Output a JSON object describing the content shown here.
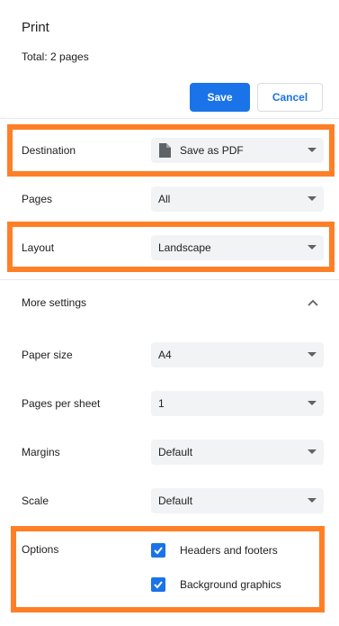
{
  "header": {
    "title": "Print",
    "total_label": "Total: ",
    "total_value": "2 pages"
  },
  "buttons": {
    "save": "Save",
    "cancel": "Cancel"
  },
  "settings": {
    "destination": {
      "label": "Destination",
      "value": "Save as PDF",
      "icon": "document-icon"
    },
    "pages": {
      "label": "Pages",
      "value": "All"
    },
    "layout": {
      "label": "Layout",
      "value": "Landscape"
    },
    "more_settings": {
      "label": "More settings",
      "icon": "chevron-up-icon"
    },
    "paper_size": {
      "label": "Paper size",
      "value": "A4"
    },
    "pages_per_sheet": {
      "label": "Pages per sheet",
      "value": "1"
    },
    "margins": {
      "label": "Margins",
      "value": "Default"
    },
    "scale": {
      "label": "Scale",
      "value": "Default"
    },
    "options": {
      "label": "Options",
      "items": [
        {
          "label": "Headers and footers",
          "checked": true
        },
        {
          "label": "Background graphics",
          "checked": true
        }
      ]
    }
  },
  "colors": {
    "accent": "#1a73e8",
    "highlight": "#ff7f27",
    "select_bg": "#f1f3f4"
  }
}
